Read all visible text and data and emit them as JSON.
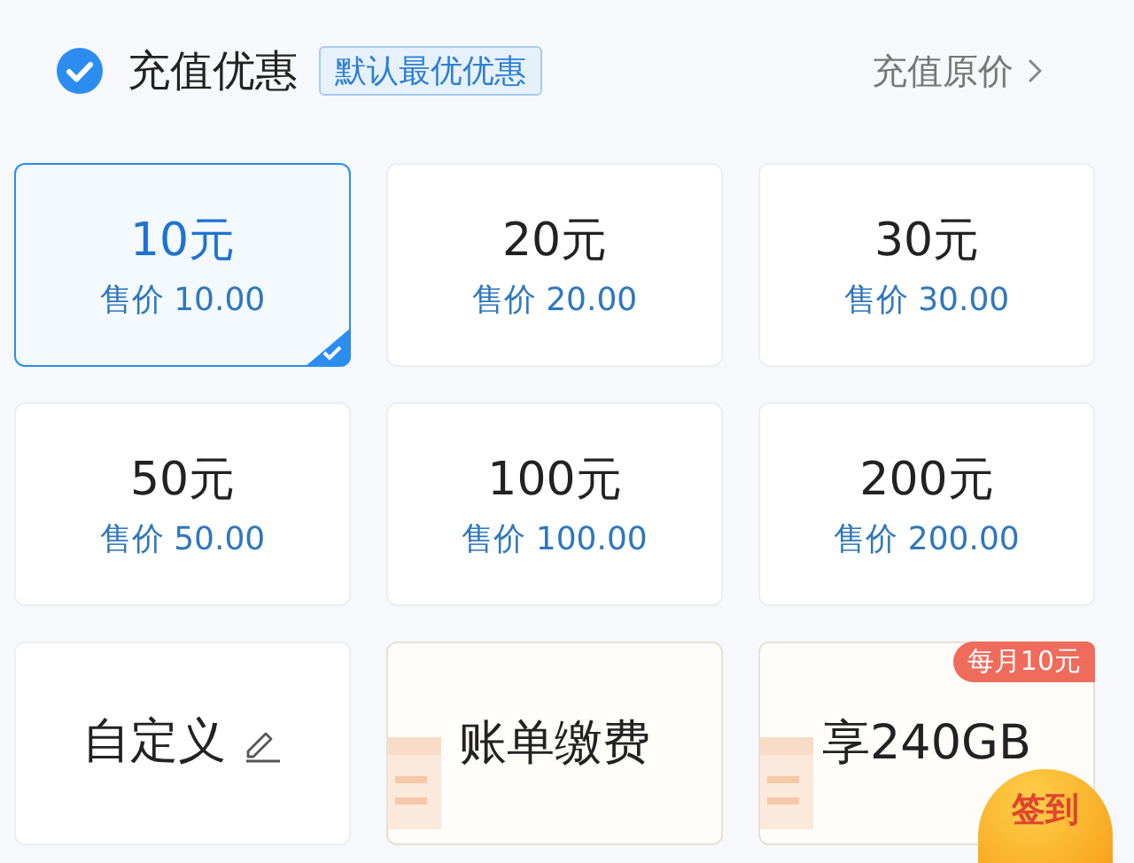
{
  "header": {
    "checked": true,
    "title": "充值优惠",
    "tag": "默认最优优惠",
    "link": "充值原价"
  },
  "cards": [
    {
      "kind": "amount",
      "amount": "10元",
      "price": "售价 10.00",
      "selected": true
    },
    {
      "kind": "amount",
      "amount": "20元",
      "price": "售价 20.00",
      "selected": false
    },
    {
      "kind": "amount",
      "amount": "30元",
      "price": "售价 30.00",
      "selected": false
    },
    {
      "kind": "amount",
      "amount": "50元",
      "price": "售价 50.00",
      "selected": false
    },
    {
      "kind": "amount",
      "amount": "100元",
      "price": "售价 100.00",
      "selected": false
    },
    {
      "kind": "amount",
      "amount": "200元",
      "price": "售价 200.00",
      "selected": false
    },
    {
      "kind": "custom",
      "label": "自定义",
      "selected": false
    },
    {
      "kind": "promo",
      "label": "账单缴费",
      "selected": false
    },
    {
      "kind": "promo",
      "label": "享240GB",
      "sticker": "签到",
      "selected": false
    }
  ],
  "corner_badge": "每月10元"
}
